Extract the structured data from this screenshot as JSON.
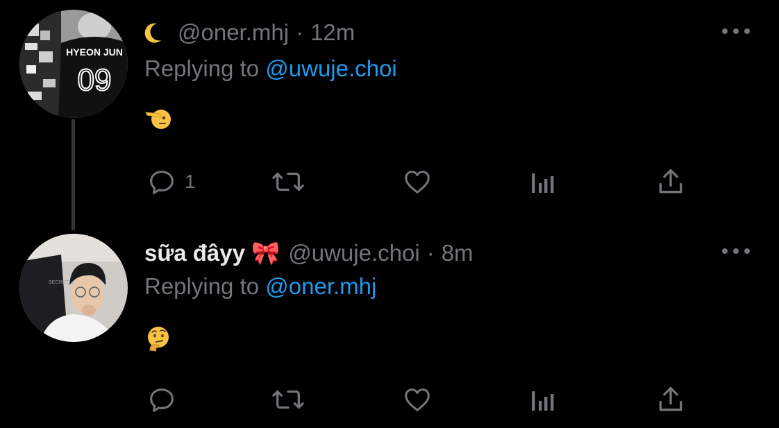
{
  "tweets": [
    {
      "display_name": "",
      "name_icon": "crescent-moon-emoji",
      "handle": "@oner.mhj",
      "separator": "·",
      "time": "12m",
      "replying_prefix": "Replying to ",
      "replying_to": "@uwuje.choi",
      "body_emoji": "saluting-face-emoji",
      "avatar_text": {
        "name": "HYEON JUN",
        "number": "09"
      },
      "actions": {
        "reply_count": "1",
        "retweet_count": "",
        "like_count": ""
      }
    },
    {
      "display_name": "sữa đâyy 🎀",
      "handle": "@uwuje.choi",
      "separator": "·",
      "time": "8m",
      "replying_prefix": "Replying to ",
      "replying_to": "@oner.mhj",
      "body_emoji": "thinking-face-emoji",
      "avatar_text": {
        "chair_brand": "SECRET LAB"
      },
      "actions": {
        "reply_count": "",
        "retweet_count": "",
        "like_count": ""
      }
    }
  ],
  "colors": {
    "background": "#000000",
    "secondary_text": "#71767b",
    "link": "#1d9bf0",
    "primary_text": "#e7e9ea",
    "thread_line": "#333639"
  }
}
